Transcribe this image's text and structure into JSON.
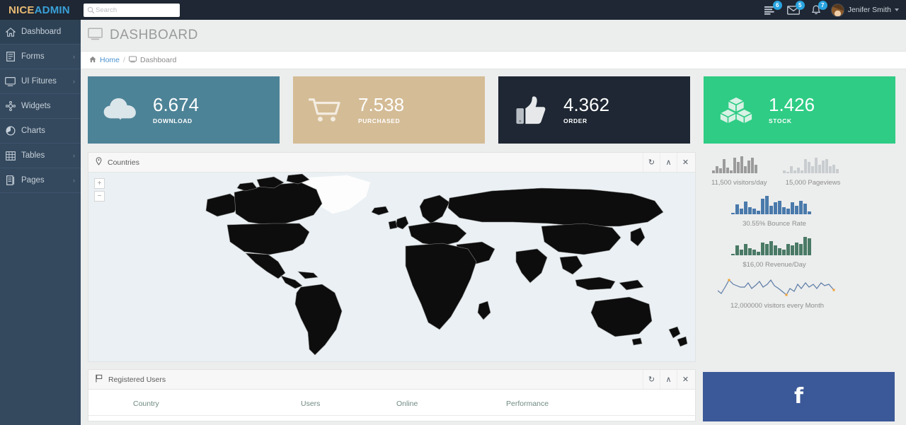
{
  "brand": {
    "first": "NICE",
    "second": "ADMIN",
    "color_first": "#e8b974",
    "color_second": "#3aa0d8"
  },
  "search": {
    "placeholder": "Search",
    "value": "",
    "icon": "search-icon"
  },
  "header": {
    "icons": [
      {
        "name": "tasks-icon",
        "badge": "6"
      },
      {
        "name": "envelope-icon",
        "badge": "5"
      },
      {
        "name": "bell-icon",
        "badge": "7"
      }
    ],
    "user": {
      "name": "Jenifer Smith",
      "caret": "chevron-down-icon"
    },
    "badge_color": "#29a3df"
  },
  "sidebar": {
    "bg": "#34495e",
    "items": [
      {
        "label": "Dashboard",
        "icon": "home-icon",
        "active": true,
        "arrow": ""
      },
      {
        "label": "Forms",
        "icon": "form-icon",
        "active": false,
        "arrow": "›"
      },
      {
        "label": "UI Fitures",
        "icon": "desktop-icon",
        "active": false,
        "arrow": "›"
      },
      {
        "label": "Widgets",
        "icon": "widgets-icon",
        "active": false,
        "arrow": ""
      },
      {
        "label": "Charts",
        "icon": "pie-chart-icon",
        "active": false,
        "arrow": ""
      },
      {
        "label": "Tables",
        "icon": "table-icon",
        "active": false,
        "arrow": "›"
      },
      {
        "label": "Pages",
        "icon": "pages-icon",
        "active": false,
        "arrow": "›"
      }
    ]
  },
  "page": {
    "title": "DASHBOARD",
    "title_icon": "desktop-icon",
    "breadcrumb": {
      "home_icon": "home-icon",
      "home": "Home",
      "separator": "/",
      "current_icon": "desktop-icon",
      "current": "Dashboard"
    }
  },
  "stat_cards": [
    {
      "value": "6.674",
      "label": "DOWNLOAD",
      "icon": "cloud-download-icon",
      "bg": "#4d8397"
    },
    {
      "value": "7.538",
      "label": "PURCHASED",
      "icon": "shopping-cart-icon",
      "bg": "#d4bc96"
    },
    {
      "value": "4.362",
      "label": "ORDER",
      "icon": "thumbs-up-icon",
      "bg": "#1e2733"
    },
    {
      "value": "1.426",
      "label": "STOCK",
      "icon": "cubes-icon",
      "bg": "#2ecc84"
    }
  ],
  "countries_panel": {
    "title": "Countries",
    "icon": "map-marker-icon",
    "tools": [
      {
        "name": "refresh-icon",
        "glyph": "↻"
      },
      {
        "name": "collapse-icon",
        "glyph": "∧"
      },
      {
        "name": "close-icon",
        "glyph": "✕"
      }
    ],
    "zoom_in": "+",
    "zoom_out": "−",
    "map_bg": "#eaf0f3",
    "land_color": "#0d0d0d"
  },
  "registered_users_panel": {
    "title": "Registered Users",
    "icon": "flag-icon",
    "tools": [
      {
        "name": "refresh-icon",
        "glyph": "↻"
      },
      {
        "name": "collapse-icon",
        "glyph": "∧"
      },
      {
        "name": "close-icon",
        "glyph": "✕"
      }
    ],
    "columns": [
      "Country",
      "Users",
      "Online",
      "Performance"
    ],
    "rows": []
  },
  "facebook_widget": {
    "icon": "facebook-icon",
    "glyph": "f",
    "bg": "#3b5998"
  },
  "chart_data": [
    {
      "type": "bar",
      "title": "11,500 visitors/day",
      "caption": "11,500 visitors/day",
      "color": "#9b9b9b",
      "values": [
        2,
        5,
        3,
        10,
        4,
        2,
        11,
        8,
        12,
        5,
        9,
        11,
        6
      ],
      "ylim": [
        0,
        13
      ]
    },
    {
      "type": "bar",
      "title": "15,000 Pageviews",
      "caption": "15,000 Pageviews",
      "color": "#c9cdd0",
      "values": [
        2,
        1,
        5,
        2,
        4,
        2,
        10,
        8,
        5,
        11,
        6,
        9,
        10,
        5,
        6,
        3
      ],
      "ylim": [
        0,
        13
      ]
    },
    {
      "type": "bar",
      "title": "30.55% Bounce Rate",
      "caption": "30.55% Bounce Rate",
      "color": "#4a7aab",
      "values": [
        1,
        5,
        3,
        7,
        4,
        3,
        2,
        10,
        13,
        6,
        8,
        9,
        5,
        4,
        8,
        6,
        9,
        7,
        2
      ],
      "ylim": [
        0,
        14
      ]
    },
    {
      "type": "bar",
      "title": "$16,00 Revenue/Day",
      "caption": "$16,00 Revenue/Day",
      "color": "#4a7a66",
      "values": [
        1,
        5,
        3,
        6,
        4,
        3,
        2,
        9,
        8,
        10,
        7,
        5,
        4,
        8,
        7,
        9,
        8,
        13,
        12
      ],
      "ylim": [
        0,
        14
      ]
    },
    {
      "type": "line",
      "title": "12,000000 visitors every Month",
      "caption": "12,000000 visitors every Month",
      "color": "#5b7ca6",
      "marker_color": "#f0a030",
      "values": [
        4,
        2,
        6,
        11,
        8,
        7,
        6,
        6,
        9,
        5,
        8,
        10,
        6,
        8,
        11,
        7,
        5,
        3,
        1,
        5,
        3,
        8,
        5,
        9,
        6,
        8,
        5,
        9,
        7,
        8,
        4
      ],
      "markers": [
        3,
        18,
        30
      ],
      "ylim": [
        0,
        12
      ]
    }
  ]
}
